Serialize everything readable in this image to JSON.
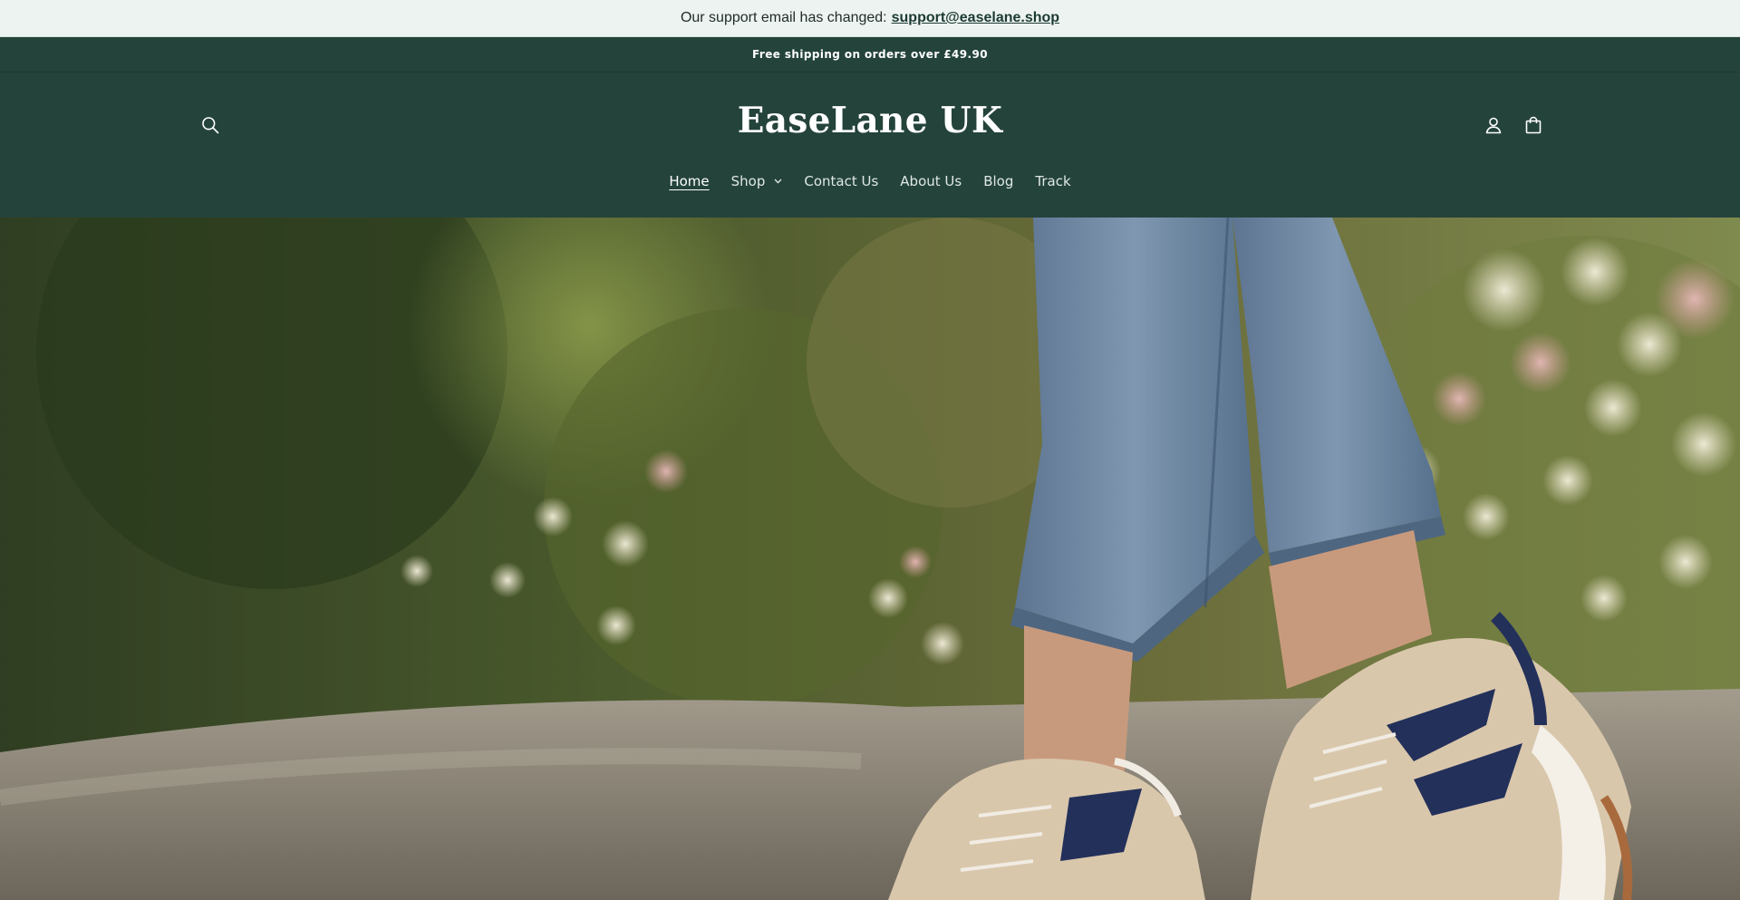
{
  "announcement": {
    "text": "Our support email has changed:",
    "email": "support@easelane.shop"
  },
  "shipping_bar": {
    "text": "Free shipping on orders over £49.90"
  },
  "header": {
    "logo": "EaseLane UK",
    "search_icon": "search-icon",
    "account_icon": "user-icon",
    "cart_icon": "shopping-bag-icon"
  },
  "nav": {
    "items": [
      {
        "label": "Home",
        "active": true
      },
      {
        "label": "Shop",
        "has_dropdown": true
      },
      {
        "label": "Contact Us"
      },
      {
        "label": "About Us"
      },
      {
        "label": "Blog"
      },
      {
        "label": "Track"
      }
    ]
  },
  "colors": {
    "header_bg": "#24433b",
    "announcement_bg": "#edf3f0",
    "text_light": "#ffffff"
  }
}
